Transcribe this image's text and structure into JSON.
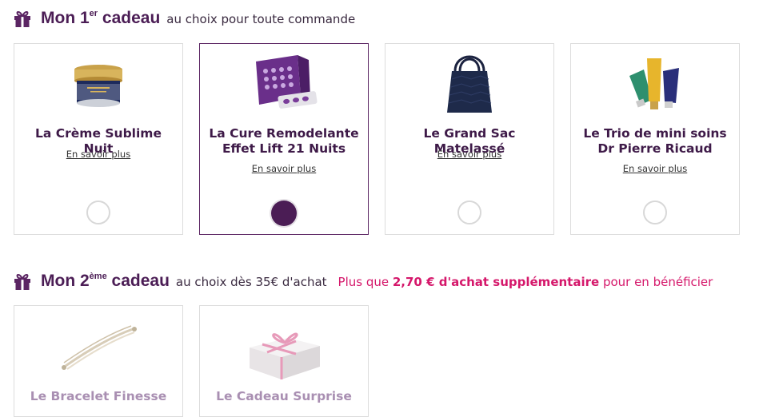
{
  "section1": {
    "title_prefix": "Mon 1",
    "title_sup": "er",
    "title_suffix": " cadeau",
    "subtitle": "au choix pour toute commande",
    "products": [
      {
        "name": "La Crème Sublime Nuit",
        "more": "En savoir plus",
        "selected": false,
        "icon": "cream-jar-icon"
      },
      {
        "name": "La Cure Remodelante Effet Lift 21 Nuits",
        "more": "En savoir plus",
        "selected": true,
        "icon": "capsule-box-icon"
      },
      {
        "name": "Le Grand Sac Matelassé",
        "more": "En savoir plus",
        "selected": false,
        "icon": "tote-bag-icon"
      },
      {
        "name": "Le Trio de mini soins Dr Pierre Ricaud",
        "more": "En savoir plus",
        "selected": false,
        "icon": "tube-trio-icon"
      }
    ]
  },
  "section2": {
    "title_prefix": "Mon 2",
    "title_sup": "ème",
    "title_suffix": " cadeau",
    "subtitle": "au choix dès 35€ d'achat",
    "promo_pre": "Plus que ",
    "promo_bold": "2,70 € d'achat supplémentaire",
    "promo_post": " pour en bénéficier",
    "products": [
      {
        "name": "Le Bracelet Finesse",
        "icon": "bracelet-icon"
      },
      {
        "name": "Le Cadeau Surprise",
        "icon": "gift-box-icon"
      }
    ]
  },
  "colors": {
    "brand": "#4b1d55",
    "promo": "#d5186b",
    "border": "#dcdcdc",
    "disabled_text": "#a98fb2"
  }
}
